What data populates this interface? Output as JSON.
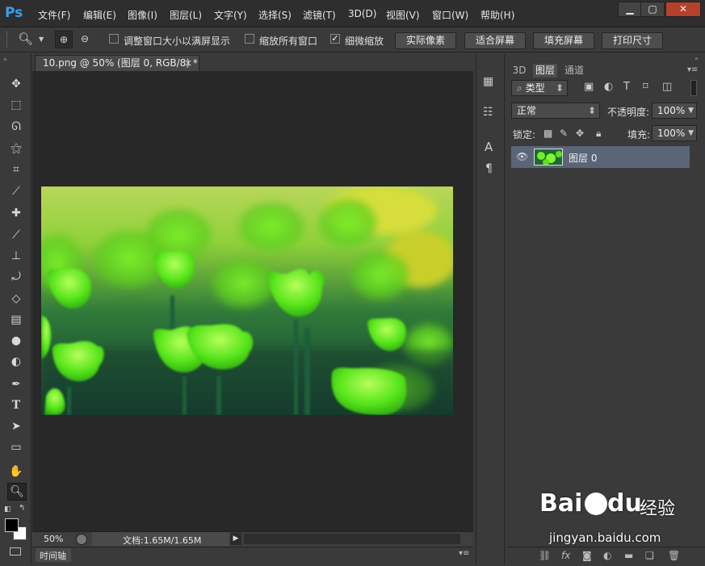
{
  "app": {
    "logo": "Ps"
  },
  "menu": [
    "文件(F)",
    "编辑(E)",
    "图像(I)",
    "图层(L)",
    "文字(Y)",
    "选择(S)",
    "滤镜(T)",
    "3D(D)",
    "视图(V)",
    "窗口(W)",
    "帮助(H)"
  ],
  "options": {
    "resize_windows_label": "调整窗口大小以满屏显示",
    "resize_windows_checked": false,
    "zoom_all_label": "缩放所有窗口",
    "zoom_all_checked": false,
    "scrubby_label": "细微缩放",
    "scrubby_checked": true,
    "actual_pixels": "实际像素",
    "fit_screen": "适合屏幕",
    "fill_screen": "填充屏幕",
    "print_size": "打印尺寸"
  },
  "document": {
    "tab_title": "10.png @ 50% (图层 0, RGB/8) *",
    "tab_close": "×",
    "zoom": "50%",
    "doc_size": "文档:1.65M/1.65M",
    "timeline_label": "时间轴"
  },
  "panel": {
    "tabs": [
      "3D",
      "图层",
      "通道"
    ],
    "active_tab": "图层",
    "filter_kind": "类型",
    "blend_mode": "正常",
    "opacity_label": "不透明度:",
    "opacity_value": "100%",
    "lock_label": "锁定:",
    "fill_label": "填充:",
    "fill_value": "100%",
    "layer_name": "图层 0"
  },
  "watermark": {
    "brand": "Bai",
    "brand2": "du",
    "suffix": "经验",
    "url": "jingyan.baidu.com"
  },
  "colors": {
    "foreground": "#000000",
    "background": "#ffffff",
    "accent": "#39a2ea",
    "layer_selected": "#5a6577"
  },
  "icons": [
    "move-icon",
    "marquee-icon",
    "lasso-icon",
    "magic-wand-icon",
    "crop-icon",
    "eyedropper-icon",
    "healing-brush-icon",
    "brush-icon",
    "clone-stamp-icon",
    "history-brush-icon",
    "eraser-icon",
    "gradient-icon",
    "blur-icon",
    "dodge-icon",
    "pen-icon",
    "type-icon",
    "path-selection-icon",
    "rectangle-icon",
    "hand-icon",
    "zoom-icon"
  ]
}
